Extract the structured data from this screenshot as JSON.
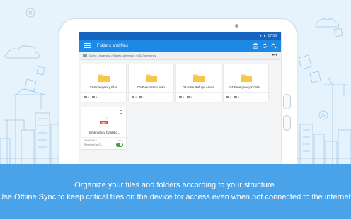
{
  "status_bar": {
    "time": "17:56"
  },
  "app_bar": {
    "title": "Folders and files"
  },
  "breadcrumb": {
    "path": "Dome University > Safety University > 06-Emergency",
    "more": "•••"
  },
  "folders": [
    {
      "name": "01-Emergency Plan",
      "subfolders": "0",
      "files": "1"
    },
    {
      "name": "02-Evacuation Map",
      "subfolders": "0",
      "files": "1"
    },
    {
      "name": "03-Safe Refuge Areas",
      "subfolders": "0",
      "files": "1"
    },
    {
      "name": "04-Emergency Conta...",
      "subfolders": "0",
      "files": "1"
    }
  ],
  "file": {
    "name": "_Emergency Dashbo...",
    "type_badge": "PDF",
    "date": "07/06/2017",
    "author": "Received by Cl...",
    "sync_label": "Sync",
    "offline_sync": true
  },
  "banner": {
    "line1": "Organize your files and folders according to your structure.",
    "line2": "Use Offline Sync to keep critical files on the device for access even when not connected to the internet."
  },
  "colors": {
    "app_bar": "#1e88e5",
    "status_bar": "#1565c0",
    "banner": "#4aa2e9",
    "folder": "#fbd36b",
    "pdf": "#e74c3c",
    "toggle_on": "#43a047"
  }
}
